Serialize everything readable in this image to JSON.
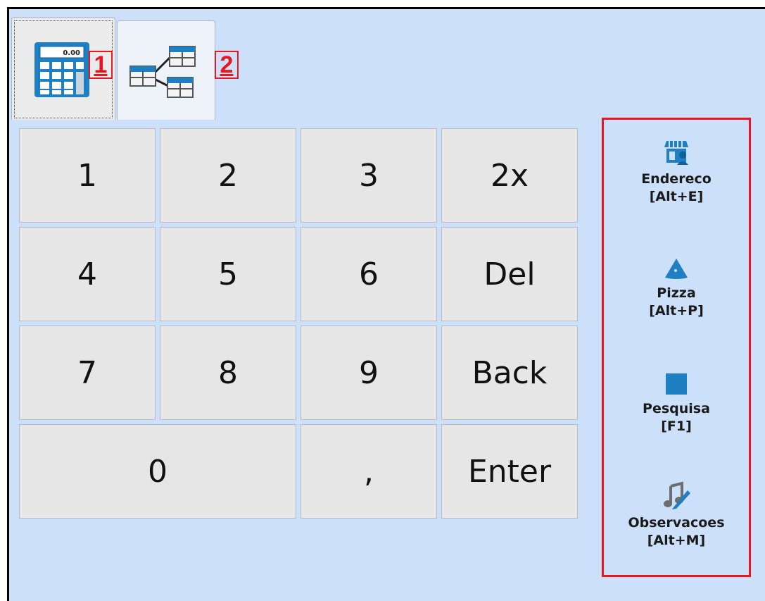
{
  "tabs": [
    {
      "name": "calculator",
      "icon": "calculator-icon",
      "badge": "1",
      "calc_display": "0.00"
    },
    {
      "name": "table-tree",
      "icon": "table-tree-icon",
      "badge": "2"
    }
  ],
  "keypad": {
    "keys": [
      "1",
      "2",
      "3",
      "2x",
      "4",
      "5",
      "6",
      "Del",
      "7",
      "8",
      "9",
      "Back",
      "0",
      ",",
      "Enter"
    ]
  },
  "side_panel": {
    "buttons": [
      {
        "label": "Endereco",
        "shortcut": "[Alt+E]",
        "icon": "store-icon"
      },
      {
        "label": "Pizza",
        "shortcut": "[Alt+P]",
        "icon": "pizza-icon"
      },
      {
        "label": "Pesquisa",
        "shortcut": "[F1]",
        "icon": "search-square-icon"
      },
      {
        "label": "Observacoes",
        "shortcut": "[Alt+M]",
        "icon": "music-note-icon"
      }
    ]
  },
  "colors": {
    "background": "#cce0fa",
    "key": "#e6e6e6",
    "highlight": "#e8161e",
    "icon": "#1e7fc2"
  }
}
